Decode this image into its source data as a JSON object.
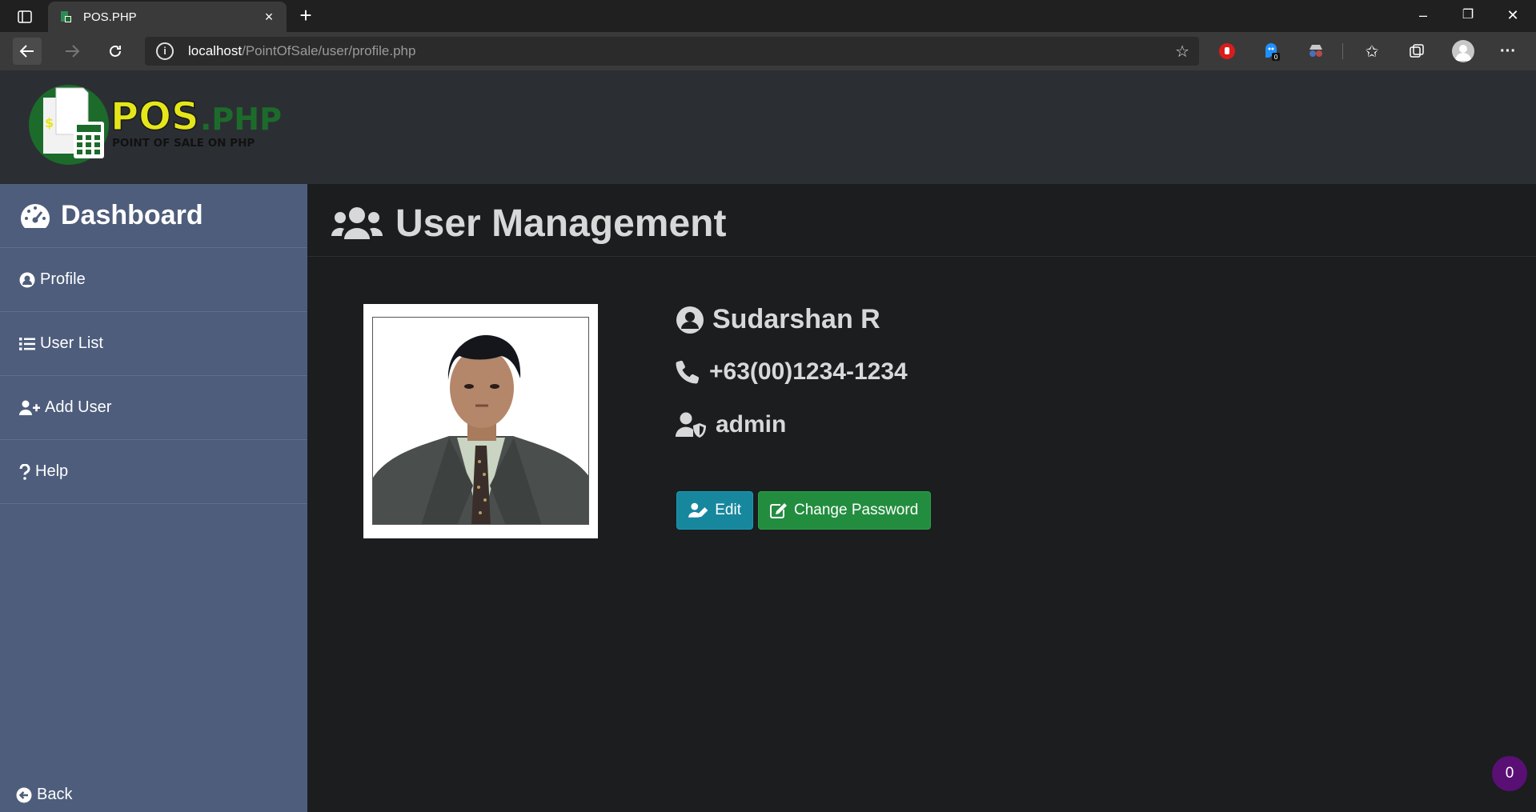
{
  "browser": {
    "tab_title": "POS.PHP",
    "tab_close": "×",
    "new_tab": "+",
    "window": {
      "minimize": "–",
      "restore": "❐",
      "close": "✕"
    },
    "url_host": "localhost",
    "url_path": "/PointOfSale/user/profile.php",
    "extension_badge": "0",
    "menu": "···"
  },
  "logo": {
    "brand": "POS",
    "brand_suffix": ".PHP",
    "tagline": "POINT OF SALE ON PHP"
  },
  "sidebar": {
    "dashboard": "Dashboard",
    "items": [
      {
        "label": "Profile",
        "icon": "user-circle-icon"
      },
      {
        "label": "User List",
        "icon": "list-icon"
      },
      {
        "label": "Add User",
        "icon": "user-plus-icon"
      },
      {
        "label": "Help",
        "icon": "question-icon"
      }
    ],
    "back": "Back"
  },
  "main": {
    "title": "User Management",
    "profile": {
      "name": "Sudarshan R",
      "phone": "+63(00)1234-1234",
      "role": "admin"
    },
    "buttons": {
      "edit": "Edit",
      "change_password": "Change Password"
    }
  },
  "notification_count": "0",
  "colors": {
    "sidebar": "#4e5d7c",
    "header": "#2b2f33",
    "content_bg": "#1b1d1f",
    "edit_button": "#17879e",
    "change_password_button": "#238d3f",
    "logo_green": "#1c6b2b",
    "logo_yellow": "#e5e619"
  }
}
